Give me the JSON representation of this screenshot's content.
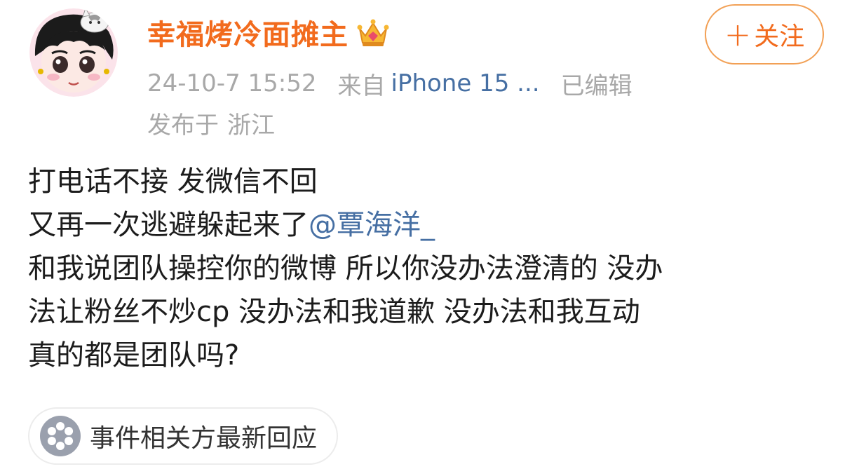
{
  "user": {
    "name": "幸福烤冷面摊主"
  },
  "follow_button": {
    "plus": "+",
    "label": "关注"
  },
  "meta": {
    "timestamp": "24-10-7 15:52",
    "source_label": "来自",
    "device": "iPhone 15 ...",
    "edited": "已编辑",
    "location_label": "发布于",
    "location": "浙江"
  },
  "content": {
    "line1": "打电话不接 发微信不回",
    "line2_text": "又再一次逃避躲起来了",
    "line2_mention": "@覃海洋_",
    "line3": "和我说团队操控你的微博  所以你没办法澄清的 没办",
    "line4": "法让粉丝不炒cp  没办法和我道歉 没办法和我互动",
    "line5": "真的都是团队吗?"
  },
  "topic_chip": {
    "label": "事件相关方最新回应"
  },
  "colors": {
    "username": "#f26b1d",
    "link": "#466fa3",
    "meta": "#a8a8a8",
    "body_text": "#1c1c1c"
  },
  "icons": {
    "avatar": "cartoon-girl-with-cat-avatar",
    "badge": "crown-icon",
    "chip": "flower-icon"
  }
}
